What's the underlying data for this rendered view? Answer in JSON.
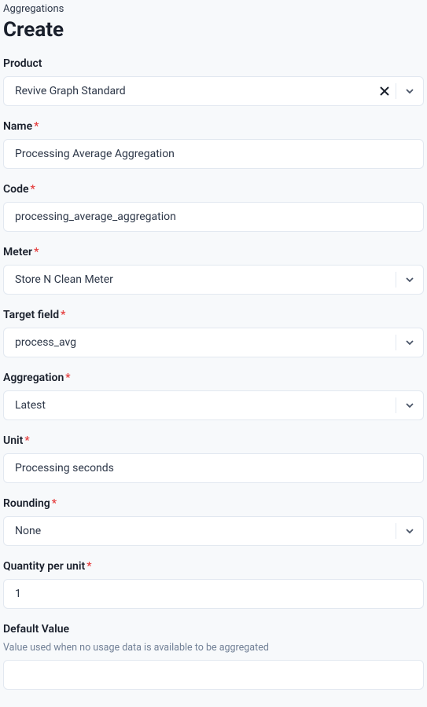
{
  "breadcrumb": "Aggregations",
  "title": "Create",
  "required_marker": "*",
  "fields": {
    "product": {
      "label": "Product",
      "value": "Revive Graph Standard"
    },
    "name": {
      "label": "Name",
      "value": "Processing Average Aggregation"
    },
    "code": {
      "label": "Code",
      "value": "processing_average_aggregation"
    },
    "meter": {
      "label": "Meter",
      "value": "Store N Clean Meter"
    },
    "target_field": {
      "label": "Target field",
      "value": "process_avg"
    },
    "aggregation": {
      "label": "Aggregation",
      "value": "Latest"
    },
    "unit": {
      "label": "Unit",
      "value": "Processing seconds"
    },
    "rounding": {
      "label": "Rounding",
      "value": "None"
    },
    "quantity_per_unit": {
      "label": "Quantity per unit",
      "value": "1"
    },
    "default_value": {
      "label": "Default Value",
      "helper": "Value used when no usage data is available to be aggregated",
      "value": ""
    }
  }
}
